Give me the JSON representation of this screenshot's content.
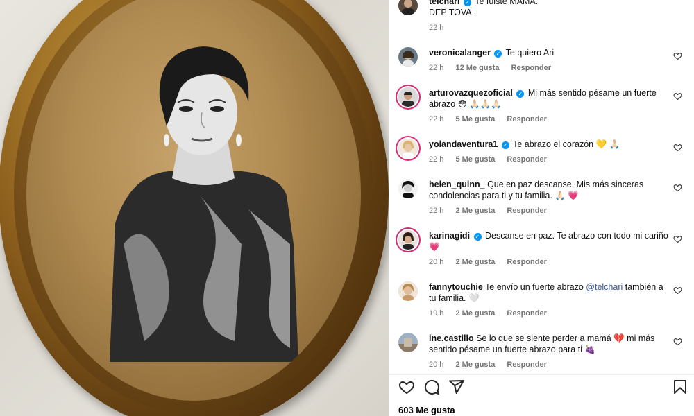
{
  "post": {
    "likes_label": "603 Me gusta"
  },
  "caption": {
    "user": "telchari",
    "text_line1": "Te fuiste MAMÁ.",
    "text_line2": "DEP TOVA.",
    "time": "22 h"
  },
  "comments": [
    {
      "user": "veronicalanger",
      "verified": true,
      "text": "Te quiero Ari",
      "time": "22 h",
      "likes": "12 Me gusta",
      "reply": "Responder"
    },
    {
      "user": "arturovazquezoficial",
      "verified": true,
      "text": "Mi más sentido pésame un fuerte abrazo 😳 🙏🏻🙏🏻🙏🏻",
      "time": "22 h",
      "likes": "5 Me gusta",
      "reply": "Responder"
    },
    {
      "user": "yolandaventura1",
      "verified": true,
      "text": "Te abrazo el corazón 💛 🙏🏻",
      "time": "22 h",
      "likes": "5 Me gusta",
      "reply": "Responder"
    },
    {
      "user": "helen_quinn_",
      "verified": false,
      "text": "Que en paz descanse. Mis más sinceras condolencias para ti y tu familia. 🙏🏻 💗",
      "time": "22 h",
      "likes": "2 Me gusta",
      "reply": "Responder"
    },
    {
      "user": "karinagidi",
      "verified": true,
      "text": "Descanse en paz. Te abrazo con todo mi cariño 💗",
      "time": "20 h",
      "likes": "2 Me gusta",
      "reply": "Responder"
    },
    {
      "user": "fannytouchie",
      "verified": false,
      "text_before": "Te envío un fuerte abrazo ",
      "mention": "@telchari",
      "text_after": " también a tu familia. 🤍",
      "time": "19 h",
      "likes": "2 Me gusta",
      "reply": "Responder"
    },
    {
      "user": "ine.castillo",
      "verified": false,
      "text": "Se lo que se siente perder a mamá 💔 mi más sentido pésame un fuerte abrazo para ti 🍇",
      "time": "20 h",
      "likes": "2 Me gusta",
      "reply": "Responder"
    }
  ],
  "icons": {
    "like": "heart-icon",
    "comment": "comment-icon",
    "share": "share-icon",
    "save": "bookmark-icon",
    "verified": "verified-badge-icon"
  },
  "colors": {
    "accent": "#0095f6",
    "meta_text": "#737373",
    "mention": "#385898",
    "story_ring": "#d62976"
  }
}
